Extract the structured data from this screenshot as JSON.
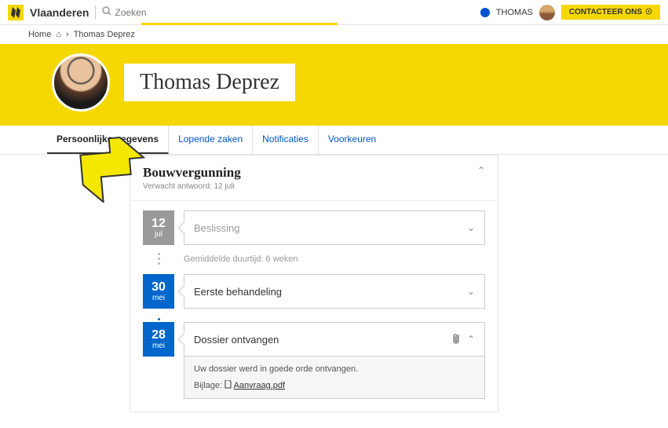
{
  "topbar": {
    "brand": "Vlaanderen",
    "search_placeholder": "Zoeken",
    "user_name": "THOMAS",
    "contact_label": "CONTACTEER ONS"
  },
  "breadcrumb": {
    "home": "Home",
    "current": "Thomas Deprez"
  },
  "hero": {
    "name": "Thomas Deprez"
  },
  "tabs": {
    "t1": "Persoonlijke gegevens",
    "t2": "Lopende zaken",
    "t3": "Notificaties",
    "t4": "Voorkeuren"
  },
  "panel": {
    "title": "Bouwvergunning",
    "subtitle": "Verwacht antwoord: 12 juli"
  },
  "timeline": {
    "step1": {
      "day": "12",
      "month": "jul",
      "label": "Beslissing"
    },
    "duration": "Gemiddelde duurtijd: 6 weken",
    "step2": {
      "day": "30",
      "month": "mei",
      "label": "Eerste behandeling"
    },
    "step3": {
      "day": "28",
      "month": "mei",
      "label": "Dossier ontvangen"
    },
    "detail": {
      "text": "Uw dossier werd in goede orde ontvangen.",
      "bijlage_label": "Bijlage:",
      "file": "Aanvraag.pdf"
    }
  }
}
